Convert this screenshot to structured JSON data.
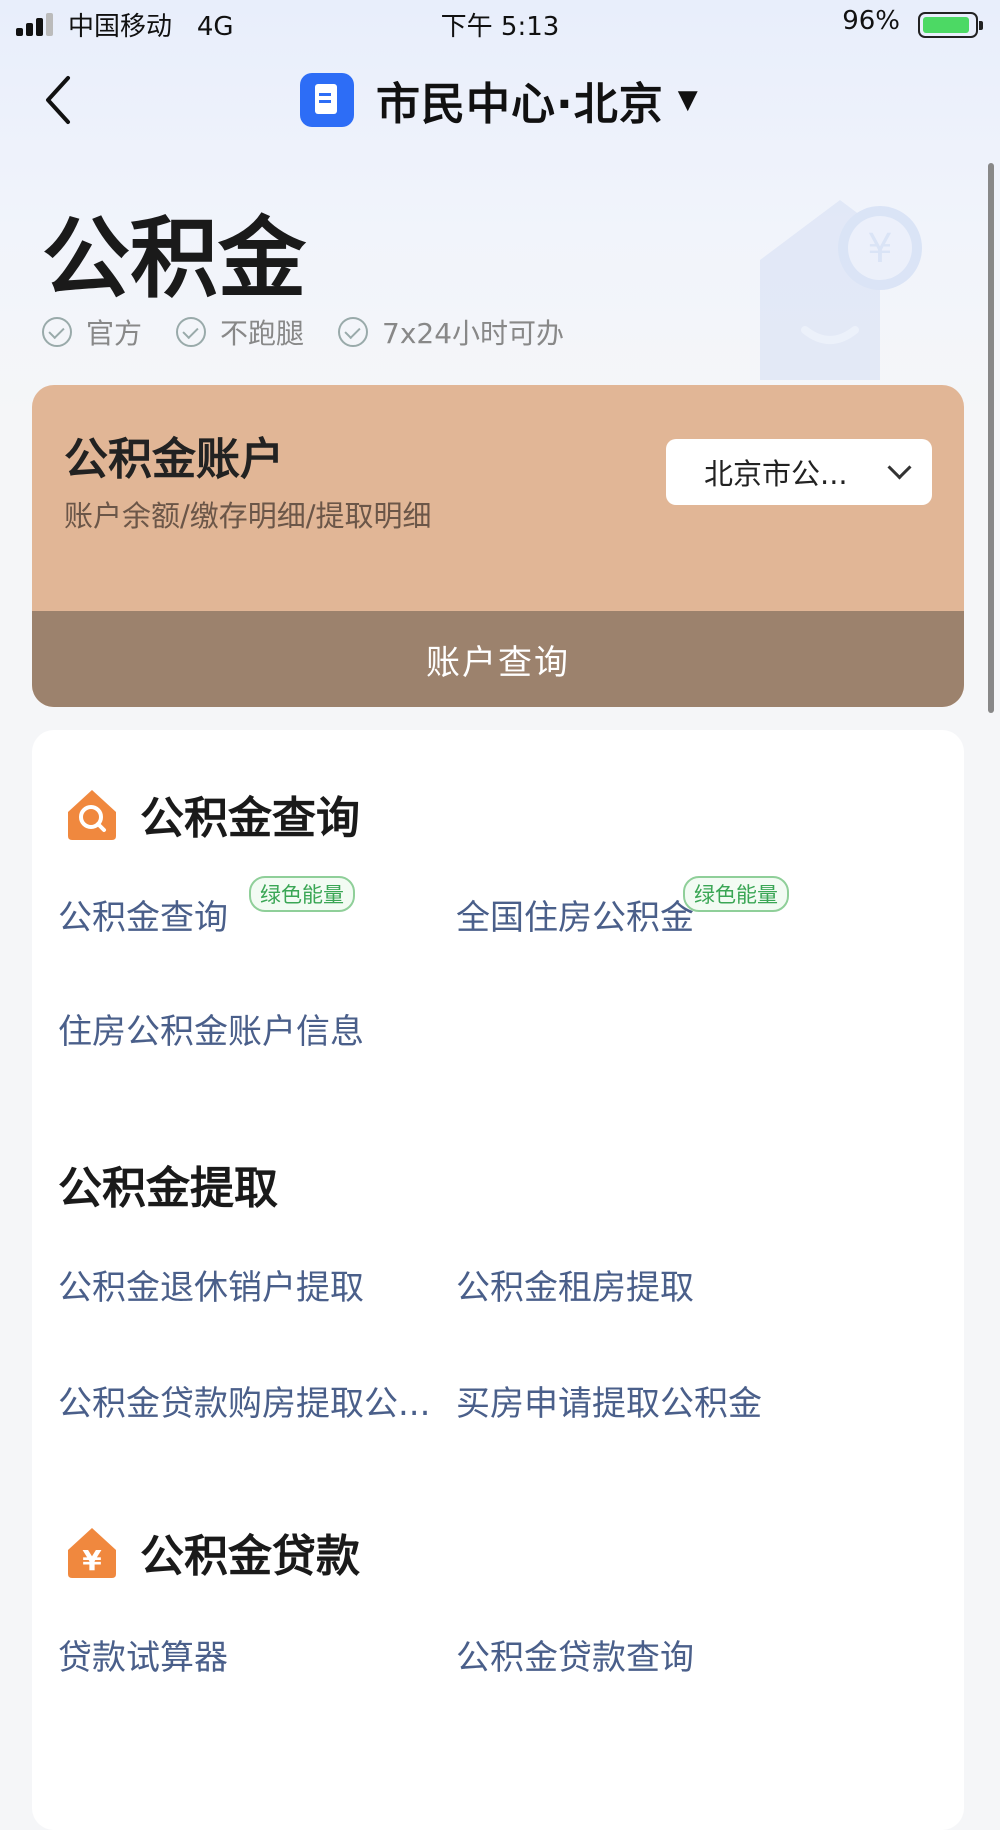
{
  "status_bar": {
    "carrier": "中国移动",
    "network": "4G",
    "time": "下午 5:13",
    "battery": "96%"
  },
  "nav": {
    "title": "市民中心·北京",
    "caret": "▼"
  },
  "header": {
    "title": "公积金",
    "tags": [
      "官方",
      "不跑腿",
      "7x24小时可办"
    ]
  },
  "account_card": {
    "title": "公积金账户",
    "subtitle": "账户余额/缴存明细/提取明细",
    "region_select": "北京市公...",
    "action": "账户查询"
  },
  "sections": {
    "query": {
      "title": "公积金查询",
      "items": [
        "公积金查询",
        "全国住房公积金",
        "住房公积金账户信息"
      ],
      "badge": "绿色能量"
    },
    "withdraw": {
      "title": "公积金提取",
      "items": [
        "公积金退休销户提取",
        "公积金租房提取",
        "公积金贷款购房提取公...",
        "买房申请提取公积金"
      ]
    },
    "loan": {
      "title": "公积金贷款",
      "items": [
        "贷款试算器",
        "公积金贷款查询"
      ]
    }
  },
  "colors": {
    "accent": "#2d6df6",
    "card": "#e1b696",
    "card_bottom": "#9c826d",
    "link": "#4a5f8a",
    "icon_orange": "#f0883e"
  }
}
